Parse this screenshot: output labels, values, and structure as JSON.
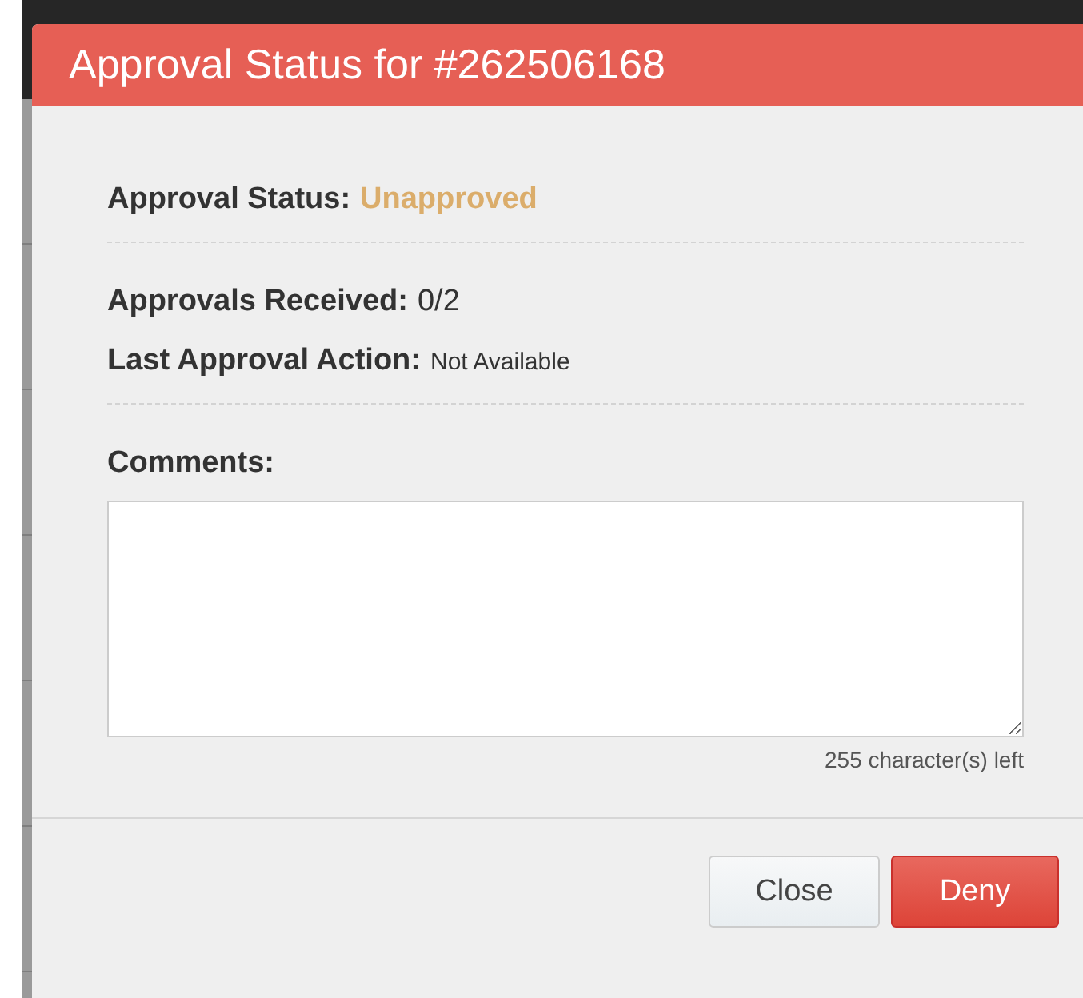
{
  "dialog": {
    "title": "Approval Status for #262506168",
    "status": {
      "label": "Approval Status:",
      "value": "Unapproved"
    },
    "details": [
      {
        "label": "Approvals Received:",
        "value": "0/2",
        "kind": "large"
      },
      {
        "label": "Last Approval Action:",
        "value": "Not Available",
        "kind": "small"
      }
    ],
    "comments": {
      "label": "Comments:",
      "counter": "255 character(s) left"
    },
    "buttons": [
      {
        "label": "Close",
        "kind": "default"
      },
      {
        "label": "Deny",
        "kind": "danger"
      }
    ]
  }
}
